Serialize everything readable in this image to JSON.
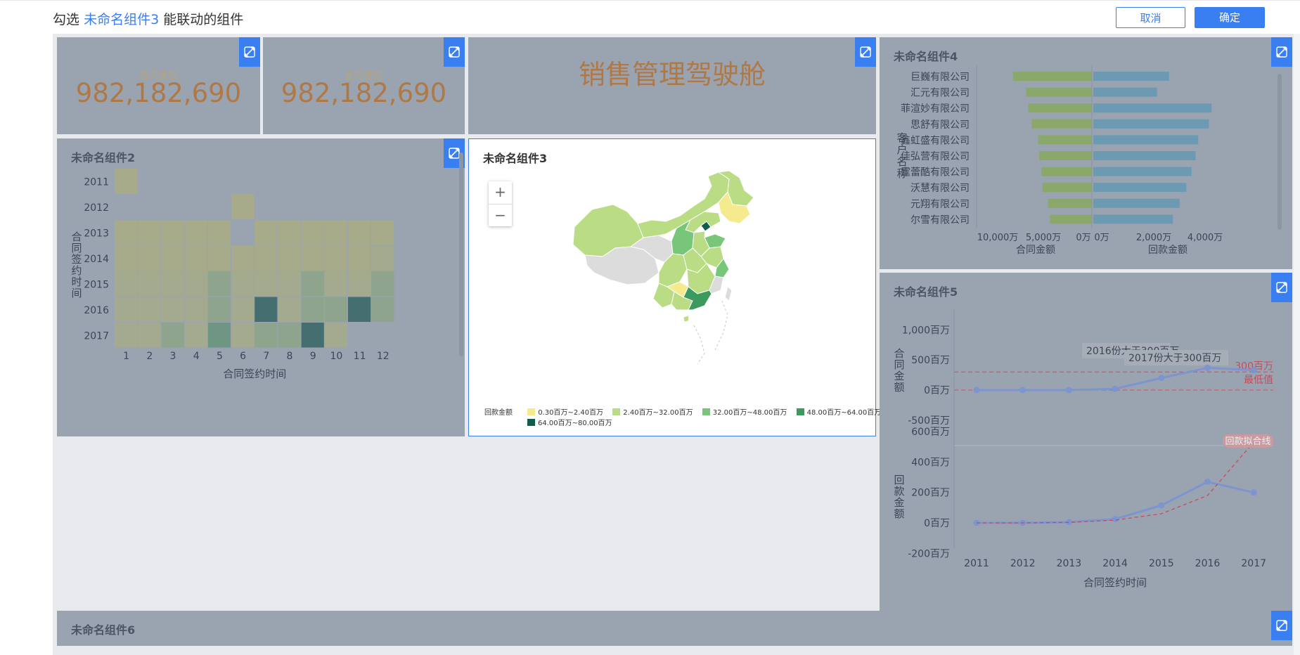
{
  "header": {
    "prefix": "勾选",
    "component": "未命名组件3",
    "suffix": "能联动的组件",
    "cancel_label": "取消",
    "ok_label": "确定"
  },
  "kpi1": {
    "label": "合同金额",
    "value": "982,182,690"
  },
  "kpi2": {
    "label": "合同金额",
    "value": "982,182,690"
  },
  "dashboard_title": "销售管理驾驶舱",
  "panel2": {
    "title": "未命名组件2"
  },
  "panel3": {
    "title": "未命名组件3",
    "zoom_in": "+",
    "zoom_out": "−"
  },
  "panel4": {
    "title": "未命名组件4"
  },
  "panel5": {
    "title": "未命名组件5"
  },
  "panel6": {
    "title": "未命名组件6"
  },
  "map_legend": {
    "title": "回款金额",
    "items": [
      {
        "label": "0.30百万~2.40百万",
        "color": "#f6ea8f"
      },
      {
        "label": "2.40百万~32.00百万",
        "color": "#b9dc84"
      },
      {
        "label": "32.00百万~48.00百万",
        "color": "#78c679"
      },
      {
        "label": "48.00百万~64.00百万",
        "color": "#3c9a5f"
      },
      {
        "label": "64.00百万~80.00百万",
        "color": "#0f5e4c"
      }
    ]
  },
  "colors": {
    "accent": "#3a7ff2",
    "kpi_value": "#b07844",
    "panel_bg": "#9aa4b1",
    "line": "#7c94cf",
    "ref_line": "#d4596a"
  },
  "chart_data": [
    {
      "type": "heatmap",
      "title": "未命名组件2",
      "xlabel": "合同签约时间",
      "ylabel": "合同签约时间",
      "x": [
        "1",
        "2",
        "3",
        "4",
        "5",
        "6",
        "7",
        "8",
        "9",
        "10",
        "11",
        "12"
      ],
      "y": [
        "2011",
        "2012",
        "2013",
        "2014",
        "2015",
        "2016",
        "2017"
      ],
      "values": [
        [
          1,
          0,
          0,
          0,
          0,
          0,
          0,
          0,
          0,
          0,
          0,
          0
        ],
        [
          0,
          0,
          0,
          0,
          0,
          1,
          0,
          0,
          0,
          0,
          0,
          0
        ],
        [
          1,
          1,
          1,
          1,
          1,
          0,
          1,
          1,
          1,
          1,
          1,
          1
        ],
        [
          1,
          1,
          1,
          1,
          1,
          1,
          1,
          1,
          1,
          1,
          1,
          2
        ],
        [
          2,
          2,
          2,
          2,
          3,
          2,
          2,
          2,
          3,
          2,
          2,
          3
        ],
        [
          2,
          2,
          2,
          2,
          3,
          2,
          5,
          2,
          3,
          3,
          5,
          3
        ],
        [
          2,
          2,
          3,
          2,
          4,
          2,
          3,
          3,
          5,
          2,
          0,
          0
        ]
      ]
    },
    {
      "type": "bar",
      "title": "未命名组件4",
      "ylabel": "客户名称",
      "categories": [
        "巨巍有限公司",
        "汇元有限公司",
        "菲渲妙有限公司",
        "思舒有限公司",
        "鑫虹盛有限公司",
        "佳弘营有限公司",
        "霆蕾酷有限公司",
        "沃慧有限公司",
        "元翔有限公司",
        "尔雪有限公司"
      ],
      "series": [
        {
          "name": "合同金额",
          "values": [
            7200,
            6000,
            5800,
            5500,
            4900,
            4800,
            4600,
            4500,
            4000,
            3800
          ]
        },
        {
          "name": "回款金额",
          "values": [
            2850,
            2400,
            4450,
            4350,
            3950,
            3850,
            3700,
            3500,
            3250,
            3000
          ]
        }
      ],
      "xlabels": [
        "合同金额",
        "回款金额"
      ],
      "left_ticks": [
        "10,000万",
        "5,000万",
        "0万"
      ],
      "right_ticks": [
        "0万",
        "2,000万",
        "4,000万"
      ]
    },
    {
      "type": "line",
      "title": "未命名组件5",
      "xlabel": "合同签约时间",
      "x": [
        "2011",
        "2012",
        "2013",
        "2014",
        "2015",
        "2016",
        "2017"
      ],
      "series": [
        {
          "name": "合同金额",
          "values": [
            0,
            0,
            0,
            20,
            200,
            370,
            330
          ]
        },
        {
          "name": "回款金额",
          "values": [
            0,
            0,
            5,
            25,
            115,
            270,
            200
          ]
        }
      ],
      "top_axis": {
        "label": "合同金额",
        "ticks": [
          "1,000百万",
          "500百万",
          "0百万",
          "-500百万"
        ],
        "ylim": [
          -500,
          1000
        ]
      },
      "bottom_axis": {
        "label": "回款金额",
        "ticks": [
          "600百万",
          "400百万",
          "200百万",
          "0百万",
          "-200百万"
        ],
        "ylim": [
          -200,
          600
        ]
      },
      "ref_lines": [
        {
          "label": "300百万",
          "value": 300
        },
        {
          "label": "最低值",
          "value": 0
        }
      ],
      "annotations": [
        "2016份大于300百万",
        "2017份大于300百万",
        "回款拟合线"
      ],
      "trend": [
        0,
        0,
        3,
        18,
        60,
        180,
        530
      ]
    }
  ]
}
